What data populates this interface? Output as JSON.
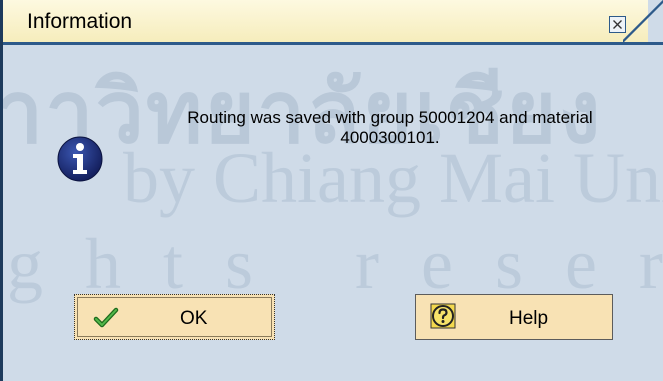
{
  "dialog": {
    "title": "Information",
    "message_line1": "Routing was saved with group 50001204 and material",
    "message_line2": "4000300101.",
    "buttons": {
      "ok_label": "OK",
      "help_label": "Help"
    }
  },
  "watermark": {
    "line1": "าาวิทยาลัยเชียง",
    "line2": "by Chiang Mai Univ",
    "line3": "ghts reser"
  },
  "icons": {
    "info": "information-icon",
    "close": "close-icon",
    "ok": "checkmark-icon",
    "help": "help-icon"
  },
  "colors": {
    "background": "#cfdbe8",
    "titlebar": "#f6edbc",
    "accent": "#2d5a8a",
    "button": "#f8e2b4",
    "icon_blue": "#1a2e7a"
  }
}
